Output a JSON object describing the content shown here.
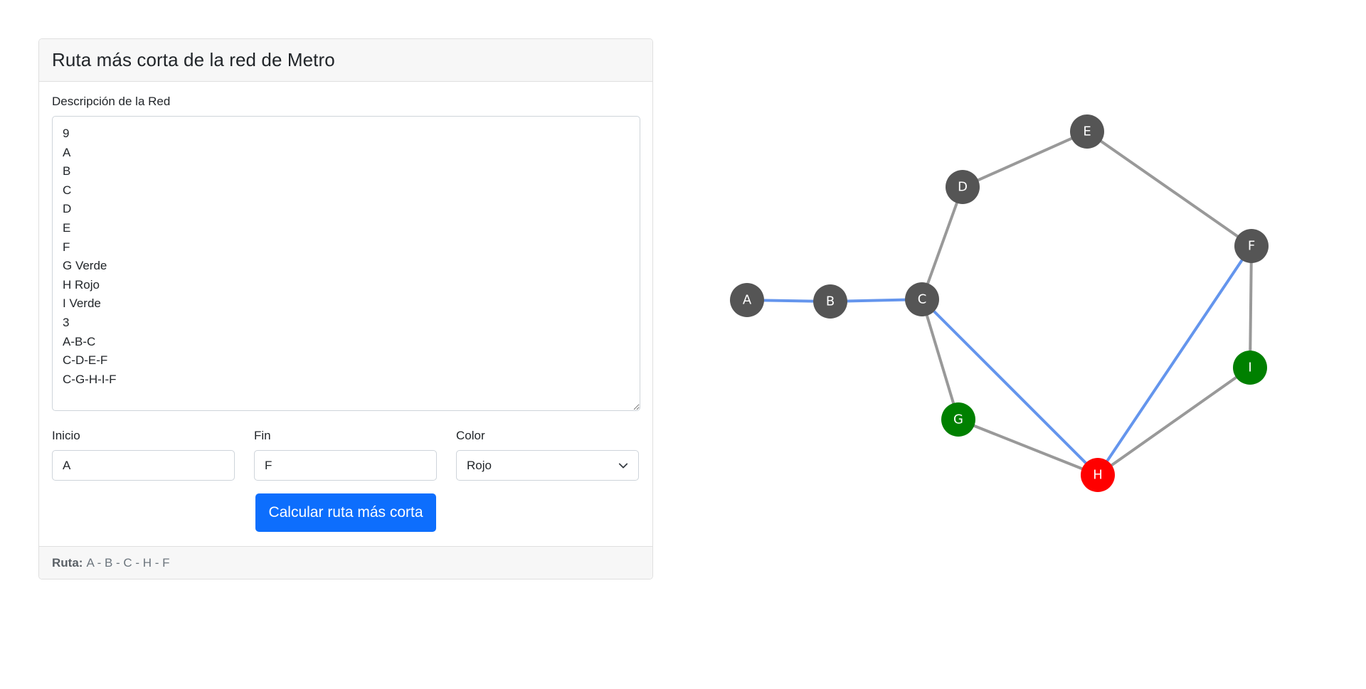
{
  "header": {
    "title": "Ruta más corta de la red de Metro"
  },
  "form": {
    "network_label": "Descripción de la Red",
    "network_value": "9\nA\nB\nC\nD\nE\nF\nG Verde\nH Rojo\nI Verde\n3\nA-B-C\nC-D-E-F\nC-G-H-I-F",
    "start_label": "Inicio",
    "start_value": "A",
    "end_label": "Fin",
    "end_value": "F",
    "color_label": "Color",
    "color_value": "Rojo",
    "submit_label": "Calcular ruta más corta"
  },
  "result": {
    "route_label": "Ruta:",
    "route_value": "A - B - C - H - F"
  },
  "graph": {
    "colors": {
      "default_node": "#555555",
      "green_node": "#008000",
      "red_node": "#ff0000",
      "edge": "#999999",
      "route_edge": "#6495ed",
      "label": "#ffffff"
    },
    "nodes": [
      {
        "id": "A",
        "color": "default"
      },
      {
        "id": "B",
        "color": "default"
      },
      {
        "id": "C",
        "color": "default"
      },
      {
        "id": "D",
        "color": "default"
      },
      {
        "id": "E",
        "color": "default"
      },
      {
        "id": "F",
        "color": "default"
      },
      {
        "id": "G",
        "color": "green"
      },
      {
        "id": "H",
        "color": "red"
      },
      {
        "id": "I",
        "color": "green"
      }
    ],
    "edges": [
      {
        "from": "A",
        "to": "B",
        "route": true
      },
      {
        "from": "B",
        "to": "C",
        "route": true
      },
      {
        "from": "C",
        "to": "D",
        "route": false
      },
      {
        "from": "D",
        "to": "E",
        "route": false
      },
      {
        "from": "E",
        "to": "F",
        "route": false
      },
      {
        "from": "C",
        "to": "G",
        "route": false
      },
      {
        "from": "G",
        "to": "H",
        "route": false
      },
      {
        "from": "H",
        "to": "I",
        "route": false
      },
      {
        "from": "I",
        "to": "F",
        "route": false
      },
      {
        "from": "C",
        "to": "H",
        "route": true
      },
      {
        "from": "H",
        "to": "F",
        "route": true
      }
    ]
  }
}
